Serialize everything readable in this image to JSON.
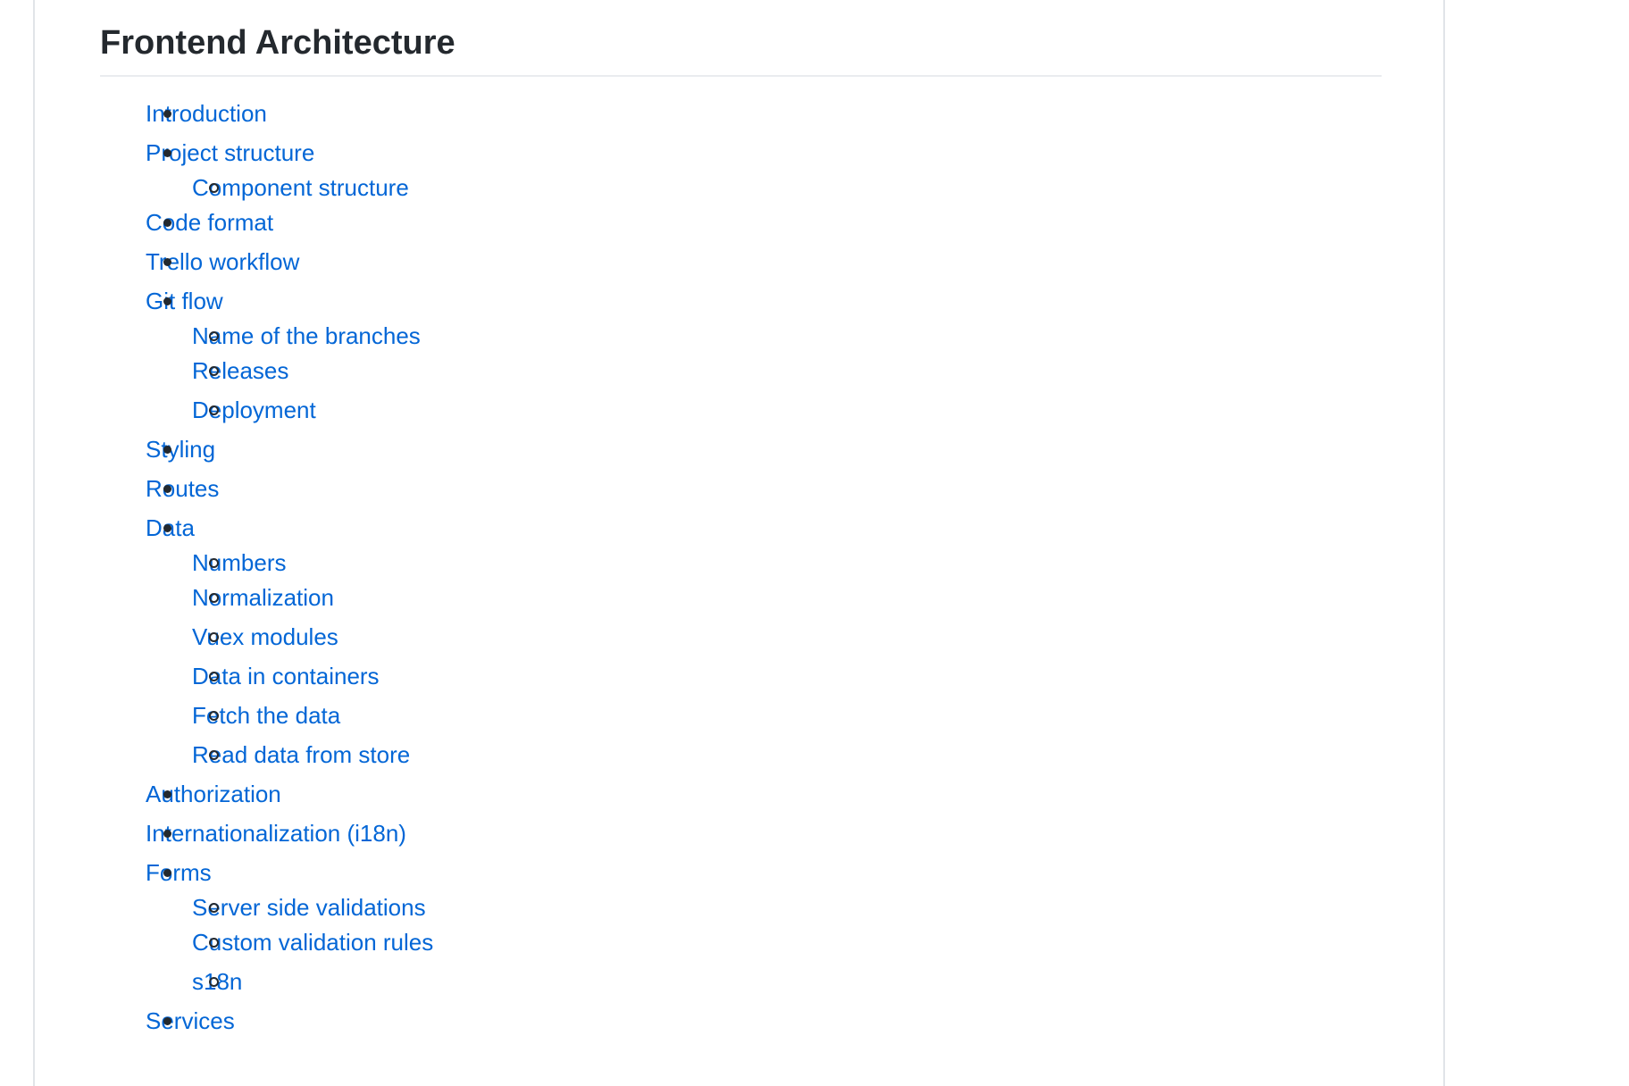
{
  "page": {
    "title": "Frontend Architecture"
  },
  "toc": [
    {
      "label": "Introduction",
      "children": []
    },
    {
      "label": "Project structure",
      "children": [
        {
          "label": "Component structure"
        }
      ]
    },
    {
      "label": "Code format",
      "children": []
    },
    {
      "label": "Trello workflow",
      "children": []
    },
    {
      "label": "Git flow",
      "children": [
        {
          "label": "Name of the branches"
        },
        {
          "label": "Releases"
        },
        {
          "label": "Deployment"
        }
      ]
    },
    {
      "label": "Styling",
      "children": []
    },
    {
      "label": "Routes",
      "children": []
    },
    {
      "label": "Data",
      "children": [
        {
          "label": "Numbers"
        },
        {
          "label": "Normalization"
        },
        {
          "label": "Vuex modules"
        },
        {
          "label": "Data in containers"
        },
        {
          "label": "Fetch the data"
        },
        {
          "label": "Read data from store"
        }
      ]
    },
    {
      "label": "Authorization",
      "children": []
    },
    {
      "label": "Internationalization (i18n)",
      "children": []
    },
    {
      "label": "Forms",
      "children": [
        {
          "label": "Server side validations"
        },
        {
          "label": "Custom validation rules"
        },
        {
          "label": "s18n"
        }
      ]
    },
    {
      "label": "Services",
      "children": []
    }
  ],
  "colors": {
    "link": "#0366d6",
    "text": "#24292e",
    "border": "#e1e4e8"
  }
}
